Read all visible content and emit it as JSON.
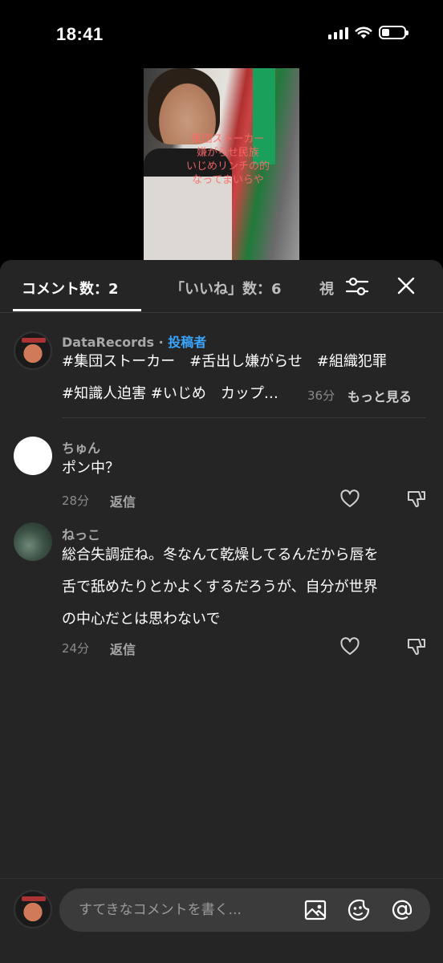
{
  "status_bar": {
    "time": "18:41",
    "battery_level": 0.35
  },
  "video": {
    "overlay_lines": [
      "集団ストーカー",
      "嫌がらせ民族",
      "いじめリンチの的",
      "なってまいらや"
    ]
  },
  "tabs": {
    "comments": "コメント数：2",
    "likes": "「いいね」数：6",
    "third": "視"
  },
  "post": {
    "author": "DataRecords",
    "badge": "投稿者",
    "line1": "#集団ストーカー　#舌出し嫌がらせ　#組織犯罪",
    "line2": "#知識人迫害 #いじめ　カップ…",
    "time": "36分",
    "more": "もっと見る"
  },
  "comments": [
    {
      "name": "ちゅん",
      "text": "ポン中？",
      "time": "28分",
      "reply": "返信"
    },
    {
      "name": "ねっこ",
      "text_lines": [
        "総合失調症ね。冬なんて乾燥してるんだから唇を",
        "舌で舐めたりとかよくするだろうが、自分が世界",
        "の中心だとは思わないで"
      ],
      "time": "24分",
      "reply": "返信"
    }
  ],
  "input": {
    "placeholder": "すてきなコメントを書く..."
  },
  "icons": {
    "filter": "sliders-icon",
    "close": "close-icon",
    "like": "heart-icon",
    "dislike": "thumbs-down-icon",
    "image": "image-icon",
    "sticker": "sticker-icon",
    "mention": "at-icon"
  }
}
